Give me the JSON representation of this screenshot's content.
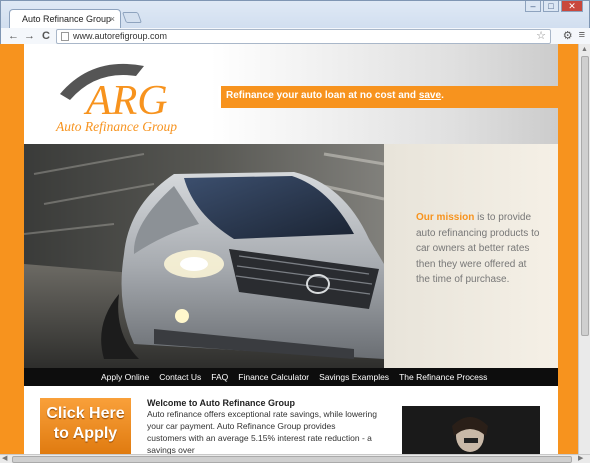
{
  "browser": {
    "tab_title": "Auto Refinance Group",
    "tab_close": "×",
    "url": "www.autorefigroup.com",
    "back": "←",
    "forward": "→",
    "reload": "C",
    "star": "☆",
    "wrench": "⚙",
    "menu": "≡",
    "min": "–",
    "max": "□",
    "close": "✕"
  },
  "logo": {
    "letters": "ARG",
    "name": "Auto Refinance Group",
    "color": "#f7931e"
  },
  "header": {
    "tagline_prefix": "Refinance your auto loan at no cost and ",
    "tagline_link": "save",
    "tagline_suffix": "."
  },
  "mission": {
    "highlight": "Our mission",
    "text": " is to provide auto refinancing products to car owners at better rates then they were offered at the time of purchase."
  },
  "nav": {
    "items": [
      "Apply Online",
      "Contact Us",
      "FAQ",
      "Finance Calculator",
      "Savings Examples",
      "The Refinance Process"
    ]
  },
  "cta": {
    "line1": "Click Here",
    "line2": "to Apply"
  },
  "welcome": {
    "title": "Welcome to Auto Refinance Group",
    "body": "Auto refinance offers exceptional rate savings, while lowering your car payment. Auto Refinance Group provides customers with an average 5.15% interest rate reduction - a savings over"
  },
  "colors": {
    "brand_orange": "#f7931e",
    "nav_bg": "#0d0d0d"
  }
}
